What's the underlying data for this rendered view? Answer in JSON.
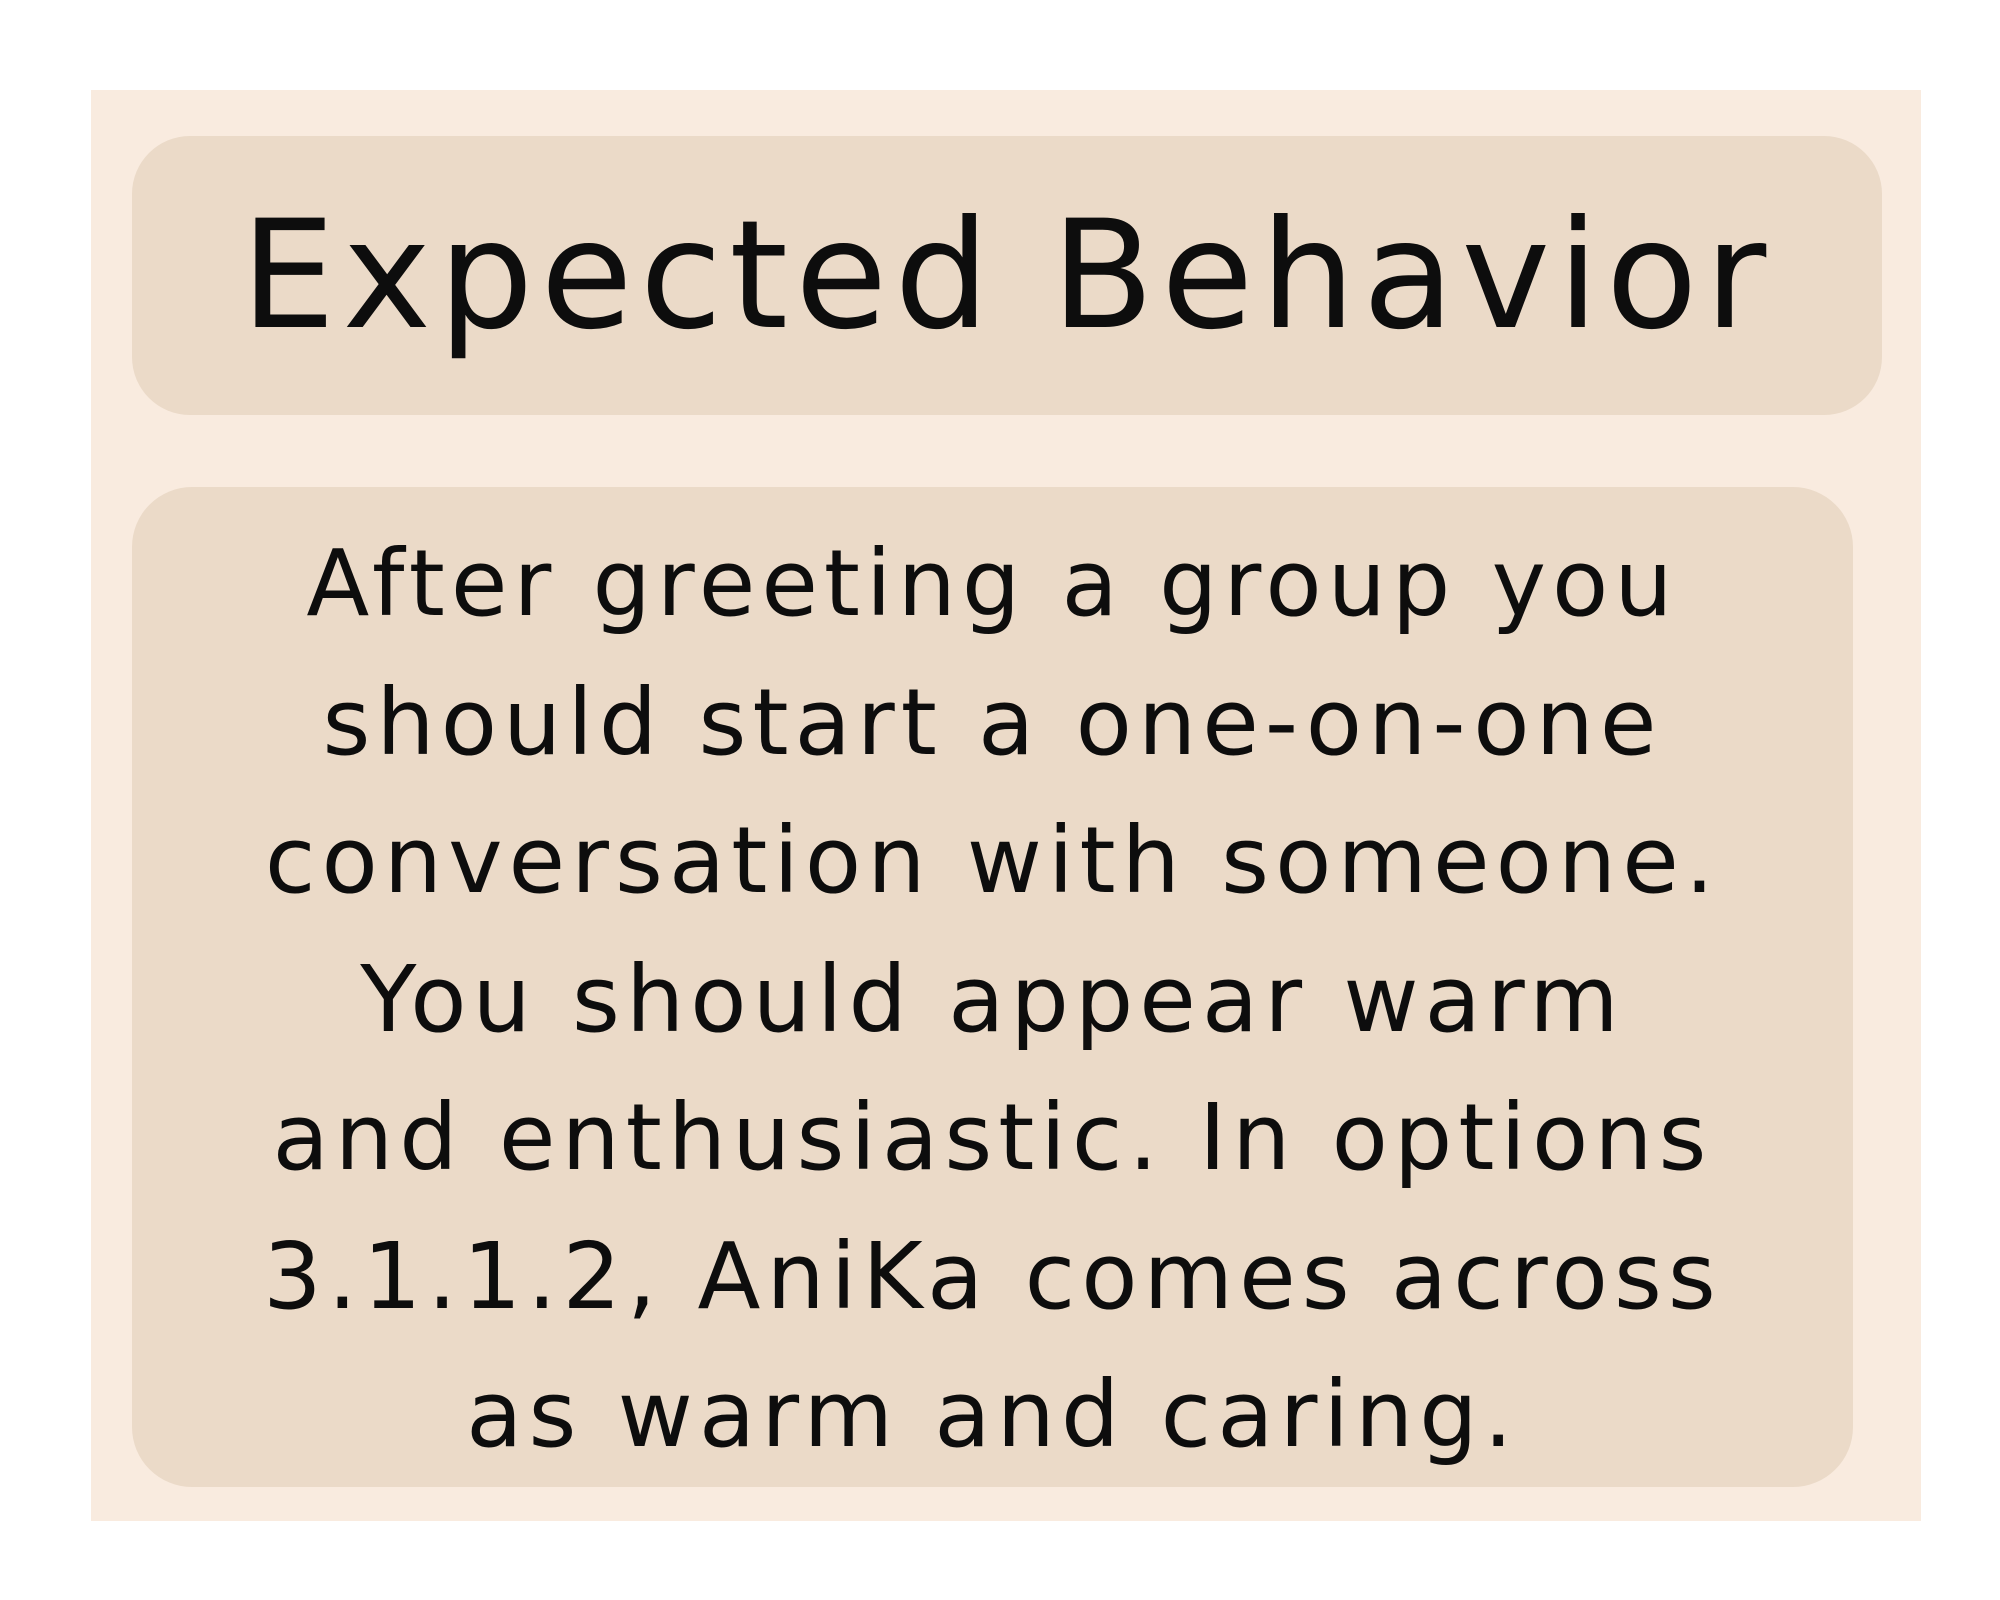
{
  "title": "Expected Behavior",
  "body_lines": [
    "After greeting a group you",
    "should start a one-on-one",
    "conversation with someone.",
    "You should appear warm",
    "and enthusiastic. In options",
    "3.1.1.2, AniKa comes across",
    "as warm and caring."
  ],
  "colors": {
    "background": "#ffffff",
    "card": "#f9ebdf",
    "box": "#ebdac8",
    "text": "#0d0d0d"
  }
}
